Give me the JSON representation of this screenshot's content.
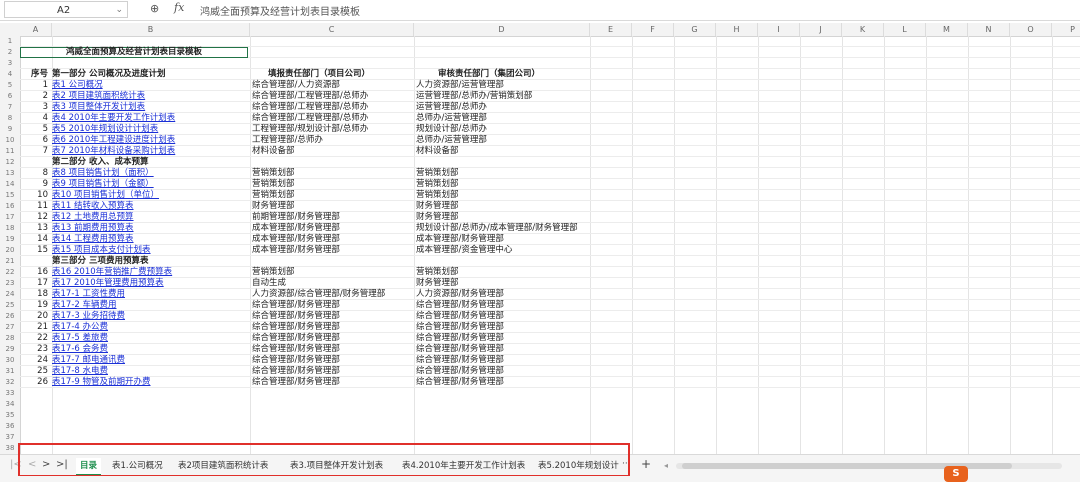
{
  "formula_bar": {
    "cell_ref": "A2",
    "fx": "fx",
    "content": "鸿威全面预算及经营计划表目录模板"
  },
  "columns": [
    "A",
    "B",
    "C",
    "D",
    "E",
    "F",
    "G",
    "H",
    "I",
    "J",
    "K",
    "L",
    "M",
    "N",
    "O",
    "P"
  ],
  "row_numbers": [
    "1",
    "2",
    "3",
    "4",
    "5",
    "6",
    "7",
    "8",
    "9",
    "10",
    "11",
    "12",
    "13",
    "14",
    "15",
    "16",
    "17",
    "18",
    "19",
    "20",
    "21",
    "22",
    "23",
    "24",
    "25",
    "26",
    "27",
    "28",
    "29",
    "30",
    "31",
    "32",
    "33",
    "34",
    "35",
    "36",
    "37",
    "38"
  ],
  "sheet": {
    "title": "鸿威全面预算及经营计划表目录模板",
    "header": {
      "seq": "序号",
      "section": "第一部分  公司概况及进度计划",
      "fill_dept": "填报责任部门（项目公司）",
      "review_dept": "审核责任部门（集团公司）"
    },
    "rows": [
      {
        "seq": "1",
        "name": "表1 公司概况",
        "link": true,
        "fill": "综合管理部/人力资源部",
        "review": "人力资源部/运营管理部"
      },
      {
        "seq": "2",
        "name": "表2 项目建筑面积统计表",
        "link": true,
        "fill": "综合管理部/工程管理部/总师办",
        "review": "运营管理部/总师办/营销策划部"
      },
      {
        "seq": "3",
        "name": "表3 项目整体开发计划表",
        "link": true,
        "fill": "综合管理部/工程管理部/总师办",
        "review": "运营管理部/总师办"
      },
      {
        "seq": "4",
        "name": "表4 2010年主要开发工作计划表",
        "link": true,
        "fill": "综合管理部/工程管理部/总师办",
        "review": "总师办/运营管理部"
      },
      {
        "seq": "5",
        "name": "表5 2010年规划设计计划表",
        "link": true,
        "fill": "工程管理部/规划设计部/总师办",
        "review": "规划设计部/总师办"
      },
      {
        "seq": "6",
        "name": "表6 2010年工程建设进度计划表",
        "link": true,
        "fill": "工程管理部/总师办",
        "review": "总师办/运营管理部"
      },
      {
        "seq": "7",
        "name": "表7 2010年材料设备采购计划表",
        "link": true,
        "fill": "材料设备部",
        "review": "材料设备部"
      },
      {
        "seq": "",
        "name": "第二部分    收入、成本预算",
        "link": false,
        "bold": true,
        "fill": "",
        "review": ""
      },
      {
        "seq": "8",
        "name": "表8 项目销售计划（面积）",
        "link": true,
        "fill": "营销策划部",
        "review": "营销策划部"
      },
      {
        "seq": "9",
        "name": "表9 项目销售计划（金额）",
        "link": true,
        "fill": "营销策划部",
        "review": "营销策划部"
      },
      {
        "seq": "10",
        "name": "表10 项目销售计划（单位）",
        "link": true,
        "fill": "营销策划部",
        "review": "营销策划部"
      },
      {
        "seq": "11",
        "name": "表11 结转收入预算表",
        "link": true,
        "fill": "财务管理部",
        "review": "财务管理部"
      },
      {
        "seq": "12",
        "name": "表12 土地费用总预算",
        "link": true,
        "fill": "前期管理部/财务管理部",
        "review": "财务管理部"
      },
      {
        "seq": "13",
        "name": "表13 前期费用预算表",
        "link": true,
        "fill": "成本管理部/财务管理部",
        "review": "规划设计部/总师办/成本管理部/财务管理部"
      },
      {
        "seq": "14",
        "name": "表14 工程费用预算表",
        "link": true,
        "fill": "成本管理部/财务管理部",
        "review": "成本管理部/财务管理部"
      },
      {
        "seq": "15",
        "name": "表15 项目成本支付计划表",
        "link": true,
        "fill": "成本管理部/财务管理部",
        "review": "成本管理部/资金管理中心"
      },
      {
        "seq": "",
        "name": "第三部分    三项费用预算表",
        "link": false,
        "bold": true,
        "fill": "",
        "review": ""
      },
      {
        "seq": "16",
        "name": "表16 2010年营销推广费预算表",
        "link": true,
        "fill": "营销策划部",
        "review": "营销策划部"
      },
      {
        "seq": "17",
        "name": "表17 2010年管理费用预算表",
        "link": true,
        "fill": "自动生成",
        "review": "财务管理部"
      },
      {
        "seq": "18",
        "name": "表17-1 工资性费用",
        "link": true,
        "fill": "人力资源部/综合管理部/财务管理部",
        "review": "人力资源部/财务管理部"
      },
      {
        "seq": "19",
        "name": "表17-2 车辆费用",
        "link": true,
        "fill": "综合管理部/财务管理部",
        "review": "综合管理部/财务管理部"
      },
      {
        "seq": "20",
        "name": "表17-3 业务招待费",
        "link": true,
        "fill": "综合管理部/财务管理部",
        "review": "综合管理部/财务管理部"
      },
      {
        "seq": "21",
        "name": "表17-4 办公费",
        "link": true,
        "fill": "综合管理部/财务管理部",
        "review": "综合管理部/财务管理部"
      },
      {
        "seq": "22",
        "name": "表17-5 差旅费",
        "link": true,
        "fill": "综合管理部/财务管理部",
        "review": "综合管理部/财务管理部"
      },
      {
        "seq": "23",
        "name": "表17-6    会务费",
        "link": true,
        "fill": "综合管理部/财务管理部",
        "review": "综合管理部/财务管理部"
      },
      {
        "seq": "24",
        "name": "表17-7    邮电通讯费",
        "link": true,
        "fill": "综合管理部/财务管理部",
        "review": "综合管理部/财务管理部"
      },
      {
        "seq": "25",
        "name": "表17-8 水电费",
        "link": true,
        "fill": "综合管理部/财务管理部",
        "review": "综合管理部/财务管理部"
      },
      {
        "seq": "26",
        "name": "表17-9 物管及前期开办费",
        "link": true,
        "fill": "综合管理部/财务管理部",
        "review": "综合管理部/财务管理部"
      }
    ]
  },
  "tabs": [
    "目录",
    "表1.公司概况",
    "表2项目建筑面积统计表",
    "表3.项目整体开发计划表",
    "表4.2010年主要开发工作计划表",
    "表5.2010年规划设计"
  ],
  "tab_more": "···",
  "tab_add": "+",
  "logo_text": "S",
  "colors": {
    "link": "#1a2fd6",
    "active_tab": "#1e8f4e",
    "highlight_box": "#e0302b",
    "selection": "#217346"
  }
}
